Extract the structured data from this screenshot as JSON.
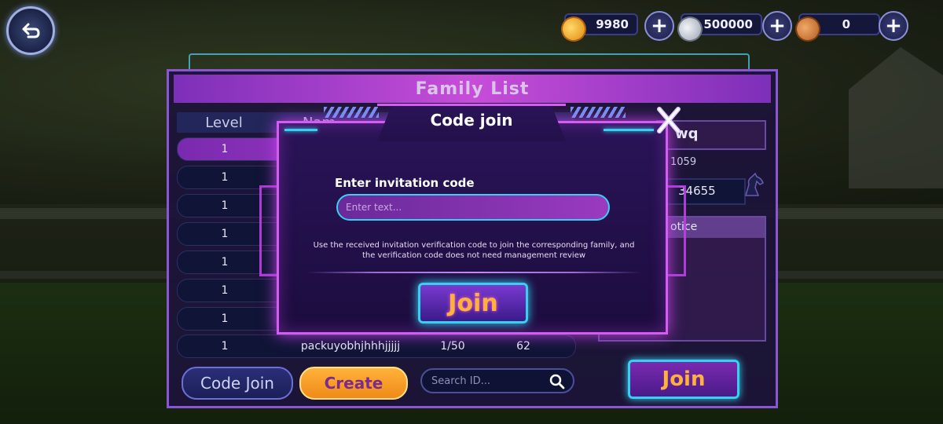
{
  "currencies": [
    {
      "name": "gold",
      "amount": "9980",
      "color": "#f5a623"
    },
    {
      "name": "silver",
      "amount": "500000",
      "color": "#c7ccd6"
    },
    {
      "name": "bronze",
      "amount": "0",
      "color": "#d9803c"
    }
  ],
  "panel": {
    "title": "Family List",
    "headers": {
      "level": "Level",
      "name": "Nam"
    },
    "rows": [
      {
        "level": "1",
        "name": "",
        "members": "",
        "power": "",
        "selected": true
      },
      {
        "level": "1",
        "name": "",
        "members": "",
        "power": "",
        "selected": false
      },
      {
        "level": "1",
        "name": "",
        "members": "",
        "power": "",
        "selected": false
      },
      {
        "level": "1",
        "name": "",
        "members": "",
        "power": "",
        "selected": false
      },
      {
        "level": "1",
        "name": "",
        "members": "",
        "power": "",
        "selected": false
      },
      {
        "level": "1",
        "name": "",
        "members": "",
        "power": "",
        "selected": false
      },
      {
        "level": "1",
        "name": "",
        "members": "",
        "power": "",
        "selected": false
      },
      {
        "level": "1",
        "name": "packuyobhjhhhjjjjj",
        "members": "1/50",
        "power": "62",
        "selected": false
      }
    ],
    "side_info": {
      "name_fragment": "wq",
      "id_fragment": "1059",
      "power_fragment": "34655",
      "notice_label": "otice"
    },
    "code_join_label": "Code Join",
    "create_label": "Create",
    "search_placeholder": "Search ID...",
    "join_label": "Join"
  },
  "modal": {
    "title": "Code join",
    "close_symbol": "X",
    "input_label": "Enter invitation code",
    "input_placeholder": "Enter text...",
    "help_text": "Use the received invitation verification code to join the corresponding family, and the verification code does not need management review",
    "join_label": "Join"
  }
}
